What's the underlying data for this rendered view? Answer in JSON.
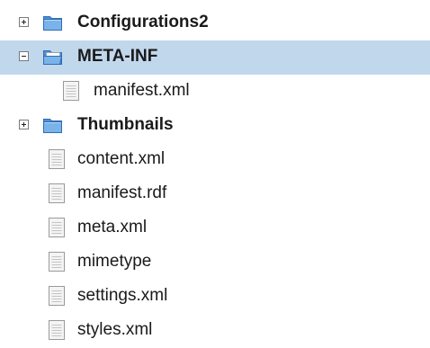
{
  "tree": {
    "items": [
      {
        "label": "Configurations2",
        "type": "folder",
        "level": 0,
        "expanded": false,
        "selected": false,
        "icon": "folder-closed-icon"
      },
      {
        "label": "META-INF",
        "type": "folder",
        "level": 0,
        "expanded": true,
        "selected": true,
        "icon": "folder-open-icon"
      },
      {
        "label": "manifest.xml",
        "type": "file",
        "level": 1,
        "selected": false,
        "icon": "file-icon"
      },
      {
        "label": "Thumbnails",
        "type": "folder",
        "level": 0,
        "expanded": false,
        "selected": false,
        "icon": "folder-closed-icon"
      },
      {
        "label": "content.xml",
        "type": "file",
        "level": 0,
        "selected": false,
        "icon": "file-icon"
      },
      {
        "label": "manifest.rdf",
        "type": "file",
        "level": 0,
        "selected": false,
        "icon": "file-icon"
      },
      {
        "label": "meta.xml",
        "type": "file",
        "level": 0,
        "selected": false,
        "icon": "file-icon"
      },
      {
        "label": "mimetype",
        "type": "file",
        "level": 0,
        "selected": false,
        "icon": "file-icon"
      },
      {
        "label": "settings.xml",
        "type": "file",
        "level": 0,
        "selected": false,
        "icon": "file-icon"
      },
      {
        "label": "styles.xml",
        "type": "file",
        "level": 0,
        "selected": false,
        "icon": "file-icon"
      }
    ]
  },
  "colors": {
    "selection": "#c1d7ec",
    "folder_fill": "#6aa5e0",
    "folder_edge": "#2f6db5",
    "file_fill": "#f4f4f4",
    "file_edge": "#9a9a9a"
  }
}
